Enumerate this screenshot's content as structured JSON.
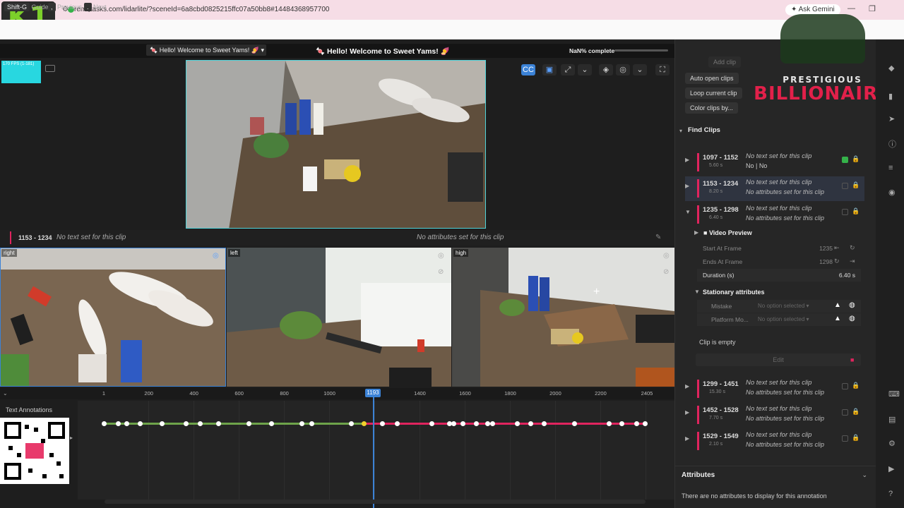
{
  "browser": {
    "logo": "K1",
    "url": "remotasks.com/lidarlite/?sceneId=6a8cbd0825215ffc07a50bb8#14484368957700",
    "ask_gemini": "✦ Ask Gemini",
    "new_tab": "+",
    "window_controls": [
      "—",
      "❐",
      "✕"
    ]
  },
  "toolbar": {
    "guide_key": "Shift-G",
    "guide_label": "Guide",
    "prev_key": ",",
    "prev_label": "Previous",
    "next_key": ".",
    "next_label": "Next",
    "scene_select": "🍬 Hello! Welcome to Sweet Yams! 🍠",
    "welcome": "🍬 Hello! Welcome to Sweet Yams! 🍠",
    "progress_text": "NaN% complete",
    "fps": "170 FPS (1-181)"
  },
  "clip_header": {
    "range": "1153 - 1234",
    "text": "No text set for this clip",
    "attrs": "No attributes set for this clip"
  },
  "cameras": [
    {
      "label": "right"
    },
    {
      "label": "left"
    },
    {
      "label": "high"
    }
  ],
  "timeline": {
    "ticks": [
      "1",
      "200",
      "400",
      "600",
      "800",
      "1000",
      "1400",
      "1600",
      "1800",
      "2000",
      "2200",
      "2405"
    ],
    "current_frame": "1193",
    "track_label": "Text Annotations"
  },
  "right_panel": {
    "add_clip": "Add clip",
    "auto_open": "Auto open clips",
    "loop_current": "Loop current clip",
    "color_clips": "Color clips by...",
    "brand_line1": "PRESTIGIOUS",
    "brand_line2": "BILLIONAIRE",
    "find_clips": "Find Clips",
    "clips": [
      {
        "range": "1097 - 1152",
        "dur": "5.60 s",
        "text": "No text set for this clip",
        "attrs": "No | No",
        "checked": true,
        "expanded": false,
        "selected": false
      },
      {
        "range": "1153 - 1234",
        "dur": "8.20 s",
        "text": "No text set for this clip",
        "attrs": "No attributes set for this clip",
        "checked": false,
        "expanded": false,
        "selected": true
      },
      {
        "range": "1235 - 1298",
        "dur": "6.40 s",
        "text": "No text set for this clip",
        "attrs": "No attributes set for this clip",
        "checked": false,
        "expanded": true,
        "selected": false
      }
    ],
    "video_preview": "Video Preview",
    "start_at_frame_label": "Start At Frame",
    "start_at_frame": "1235",
    "ends_at_frame_label": "Ends At Frame",
    "ends_at_frame": "1298",
    "duration_label": "Duration (s)",
    "duration": "6.40 s",
    "stationary_attrs": "Stationary attributes",
    "attr_mistake": "Mistake",
    "attr_platform": "Platform Mo...",
    "no_option": "No option selected",
    "clip_empty": "Clip is empty",
    "edit": "Edit",
    "clips_lower": [
      {
        "range": "1299 - 1451",
        "dur": "15.30 s",
        "text": "No text set for this clip",
        "attrs": "No attributes set for this clip"
      },
      {
        "range": "1452 - 1528",
        "dur": "7.70 s",
        "text": "No text set for this clip",
        "attrs": "No attributes set for this clip"
      },
      {
        "range": "1529 - 1549",
        "dur": "2.10 s",
        "text": "No text set for this clip",
        "attrs": "No attributes set for this clip"
      }
    ],
    "attributes_title": "Attributes",
    "attributes_empty": "There are no attributes to display for this annotation"
  },
  "colors": {
    "accent_red": "#e0245e",
    "accent_blue": "#3b82d6",
    "accent_green": "#6ea34a"
  }
}
